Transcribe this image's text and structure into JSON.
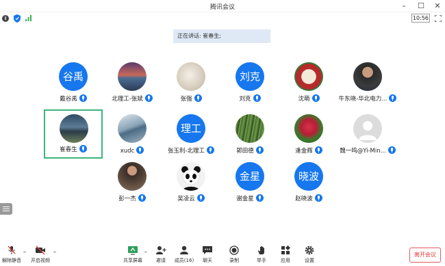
{
  "window": {
    "title": "腾讯会议",
    "time": "10:56"
  },
  "speaking": "正在讲话: 崔春生;",
  "colors": {
    "accent": "#1677ee",
    "active_border": "#3cb47a",
    "leave": "#e23b3b"
  },
  "participants": [
    {
      "name": "戴谷禹",
      "avatar_text": "谷禹"
    },
    {
      "name": "北理工-张斌",
      "avatar_text": ""
    },
    {
      "name": "张强",
      "avatar_text": ""
    },
    {
      "name": "刘克",
      "avatar_text": "刘克"
    },
    {
      "name": "沈萌",
      "avatar_text": ""
    },
    {
      "name": "牛东晓-华北电力...",
      "avatar_text": ""
    },
    {
      "name": "崔春生",
      "avatar_text": ""
    },
    {
      "name": "xudc",
      "avatar_text": ""
    },
    {
      "name": "张玉利-北理工",
      "avatar_text": "理工"
    },
    {
      "name": "郭田德",
      "avatar_text": ""
    },
    {
      "name": "逢金辉",
      "avatar_text": ""
    },
    {
      "name": "魏一鸣@Yi-Min...",
      "avatar_text": ""
    },
    {
      "name": "彭一杰",
      "avatar_text": ""
    },
    {
      "name": "吴凌云",
      "avatar_text": ""
    },
    {
      "name": "谢金星",
      "avatar_text": "金星"
    },
    {
      "name": "赵晓波",
      "avatar_text": "晓波"
    }
  ],
  "toolbar": {
    "unmute": "解除静音",
    "start_video": "开启视频",
    "share": "共享屏幕",
    "invite": "邀请",
    "members": "成员(16)",
    "chat": "聊天",
    "record": "录制",
    "raise_hand": "举手",
    "apps": "应用",
    "settings": "设置",
    "leave": "离开会议"
  }
}
